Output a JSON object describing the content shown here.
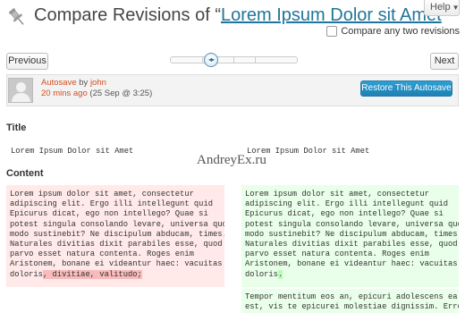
{
  "header": {
    "title_prefix": "Compare Revisions of ",
    "quote_open": "“",
    "post_title": "Lorem Ipsum Dolor sit Amet",
    "quote_close": "”",
    "help_label": "Help",
    "compare_label": "Compare any two revisions"
  },
  "nav": {
    "previous_label": "Previous",
    "next_label": "Next"
  },
  "revision": {
    "type": "Autosave",
    "by": " by ",
    "author": "john",
    "ago": "20 mins ago",
    "date": " (25 Sep @ 3:25)",
    "restore_label": "Restore This Autosave"
  },
  "diff": {
    "title_heading": "Title",
    "title_left": "Lorem Ipsum Dolor sit Amet",
    "title_right": "Lorem Ipsum Dolor sit Amet",
    "content_heading": "Content",
    "left_lines": [
      "Lorem ipsum dolor sit amet, consectetur",
      "adipiscing elit. Ergo illi intellegunt quid",
      "Epicurus dicat, ego non intellego? Quae si",
      "potest singula consolando levare, universa quo",
      "modo sustinebit? Ne discipulum abducam, times.",
      "Naturales divitias dixit parabiles esse, quod",
      "parvo esset natura contenta. Roges enim",
      "Aristonem, bonane ei videantur haec: vacuitas"
    ],
    "left_last_plain": "doloris",
    "left_last_deleted": ", divitiae, valitudo;",
    "right_lines": [
      "Lorem ipsum dolor sit amet, consectetur",
      "adipiscing elit. Ergo illi intellegunt quid",
      "Epicurus dicat, ego non intellego? Quae si",
      "potest singula consolando levare, universa quo",
      "modo sustinebit? Ne discipulum abducam, times.",
      "Naturales divitias dixit parabiles esse, quod",
      "parvo esset natura contenta. Roges enim",
      "Aristonem, bonane ei videantur haec: vacuitas"
    ],
    "right_last_plain": "doloris",
    "right_last_inserted": ".",
    "right_added_lines": [
      "Tempor mentitum eos an, epicuri adolescens ea",
      "est, vis te epicurei molestiae dignissim. Error"
    ]
  },
  "watermark": "AndreyEx.ru"
}
